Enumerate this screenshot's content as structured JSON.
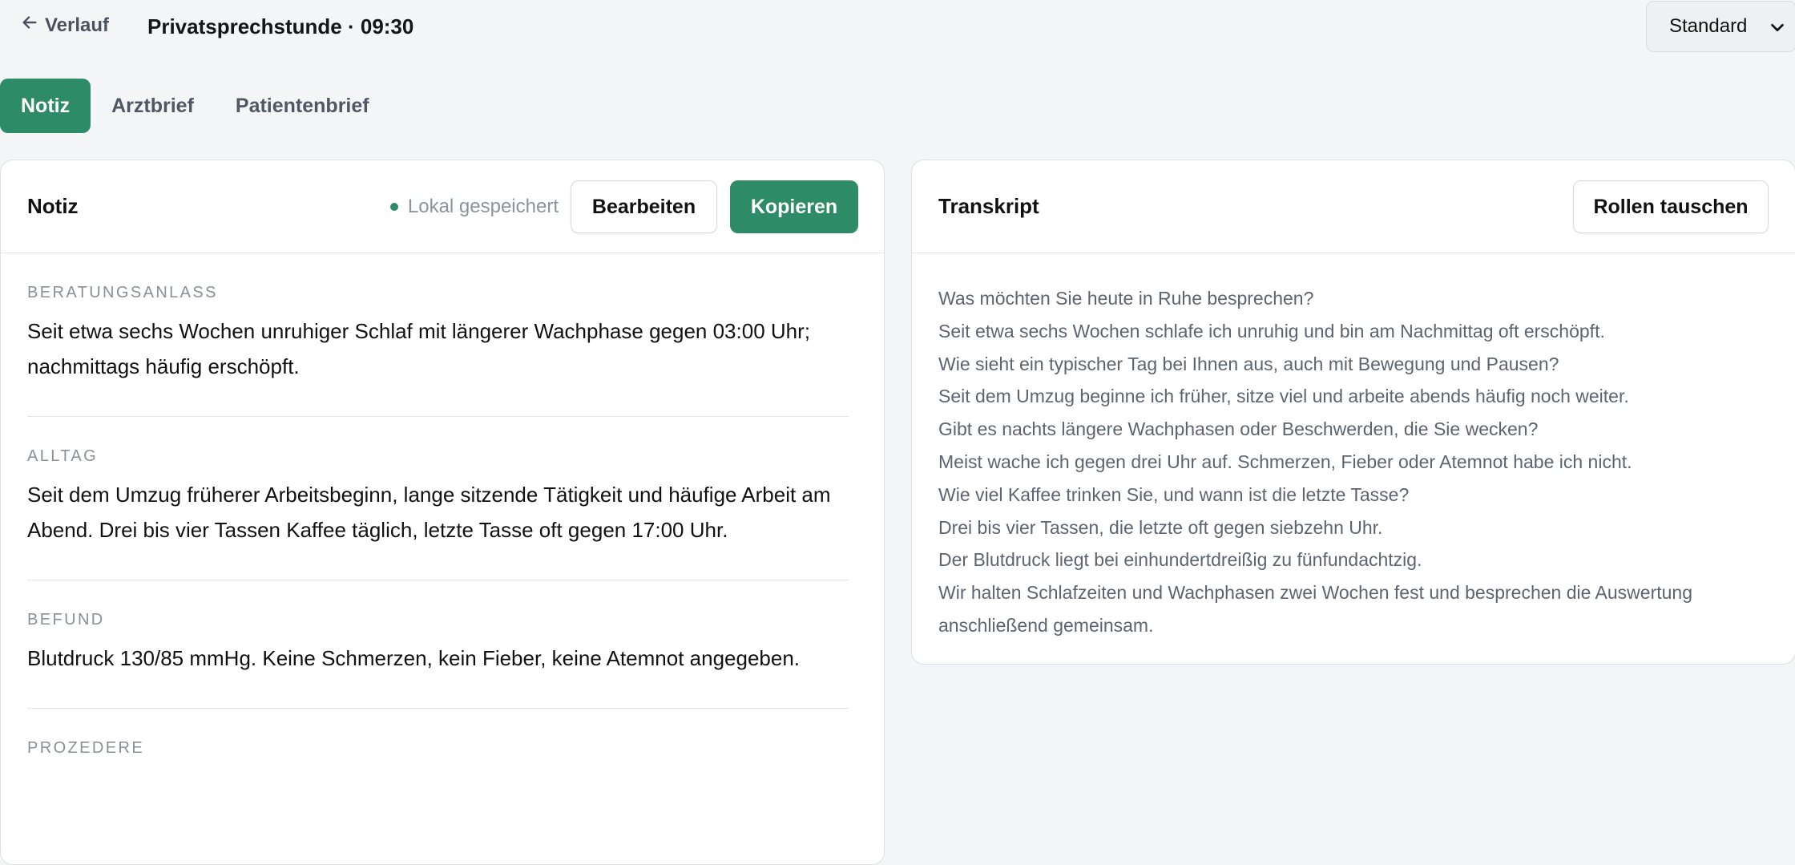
{
  "topbar": {
    "back_label": "Verlauf",
    "session_title": "Privatsprechstunde · 09:30",
    "template_selected": "Standard"
  },
  "tabs": [
    {
      "label": "Notiz",
      "active": true
    },
    {
      "label": "Arztbrief",
      "active": false
    },
    {
      "label": "Patientenbrief",
      "active": false
    }
  ],
  "note": {
    "title": "Notiz",
    "saved_status": "Lokal gespeichert",
    "edit_label": "Bearbeiten",
    "copy_label": "Kopieren",
    "sections": [
      {
        "label": "Beratungsanlass",
        "text": "Seit etwa sechs Wochen unruhiger Schlaf mit längerer Wachphase gegen 03:00 Uhr; nachmittags häufig erschöpft."
      },
      {
        "label": "Alltag",
        "text": "Seit dem Umzug früherer Arbeitsbeginn, lange sitzende Tätigkeit und häufige Arbeit am Abend. Drei bis vier Tassen Kaffee täglich, letzte Tasse oft gegen 17:00 Uhr."
      },
      {
        "label": "Befund",
        "text": "Blutdruck 130/85 mmHg. Keine Schmerzen, kein Fieber, keine Atemnot angegeben."
      },
      {
        "label": "Prozedere",
        "text": ""
      }
    ]
  },
  "transcript": {
    "title": "Transkript",
    "swap_label": "Rollen tauschen",
    "lines": [
      "Was möchten Sie heute in Ruhe besprechen?",
      "Seit etwa sechs Wochen schlafe ich unruhig und bin am Nachmittag oft erschöpft.",
      "Wie sieht ein typischer Tag bei Ihnen aus, auch mit Bewegung und Pausen?",
      "Seit dem Umzug beginne ich früher, sitze viel und arbeite abends häufig noch weiter.",
      "Gibt es nachts längere Wachphasen oder Beschwerden, die Sie wecken?",
      "Meist wache ich gegen drei Uhr auf. Schmerzen, Fieber oder Atemnot habe ich nicht.",
      "Wie viel Kaffee trinken Sie, und wann ist die letzte Tasse?",
      "Drei bis vier Tassen, die letzte oft gegen siebzehn Uhr.",
      "Der Blutdruck liegt bei einhundertdreißig zu fünfundachtzig.",
      "Wir halten Schlafzeiten und Wachphasen zwei Wochen fest und besprechen die Auswertung anschließend gemeinsam."
    ]
  },
  "colors": {
    "accent": "#2e8b67",
    "background": "#f4f5f7",
    "muted_text": "#8a9098"
  },
  "icons": {
    "back": "arrow-left-icon",
    "select": "chevron-down-icon",
    "saved": "status-dot-icon"
  }
}
